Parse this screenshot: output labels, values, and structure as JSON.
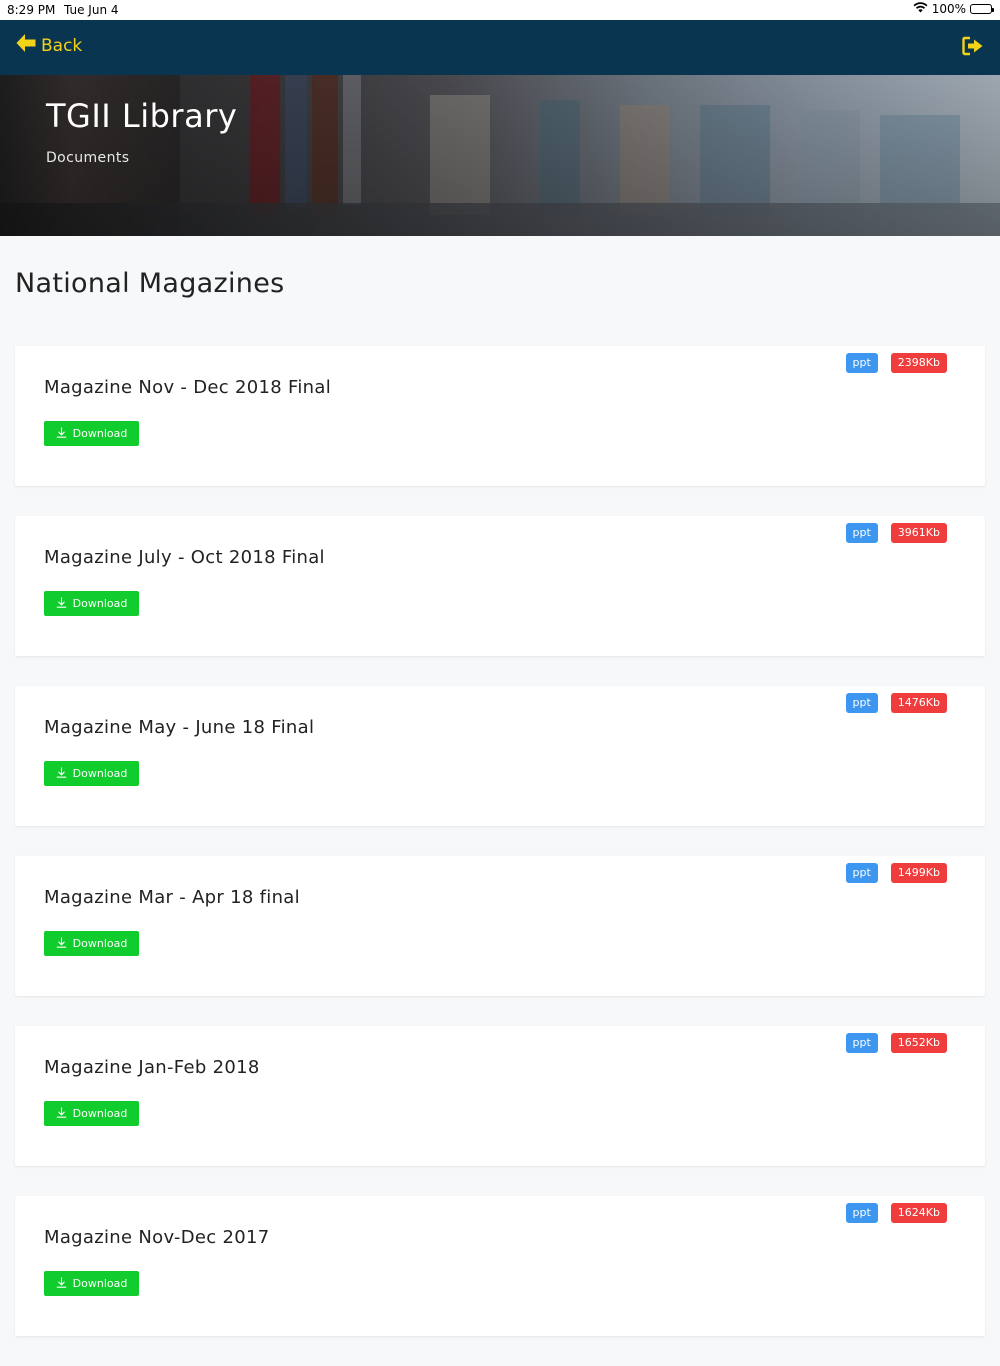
{
  "status_bar": {
    "time": "8:29 PM",
    "date": "Tue Jun 4",
    "battery": "100%"
  },
  "nav": {
    "back_label": "Back",
    "icon_color": "#f3d21a",
    "background": "#0a3550"
  },
  "hero": {
    "title": "TGII Library",
    "subtitle": "Documents"
  },
  "section": {
    "title": "National Magazines"
  },
  "documents": [
    {
      "title": "Magazine Nov - Dec 2018 Final",
      "type": "ppt",
      "size": "2398Kb",
      "download_label": "Download"
    },
    {
      "title": "Magazine July - Oct 2018 Final",
      "type": "ppt",
      "size": "3961Kb",
      "download_label": "Download"
    },
    {
      "title": "Magazine May - June 18 Final",
      "type": "ppt",
      "size": "1476Kb",
      "download_label": "Download"
    },
    {
      "title": "Magazine Mar - Apr 18 final",
      "type": "ppt",
      "size": "1499Kb",
      "download_label": "Download"
    },
    {
      "title": "Magazine Jan-Feb 2018",
      "type": "ppt",
      "size": "1652Kb",
      "download_label": "Download"
    },
    {
      "title": "Magazine Nov-Dec 2017",
      "type": "ppt",
      "size": "1624Kb",
      "download_label": "Download"
    }
  ],
  "colors": {
    "download": "#10cc2c",
    "type_badge": "#3d96f0",
    "size_badge": "#ef3d3d"
  }
}
